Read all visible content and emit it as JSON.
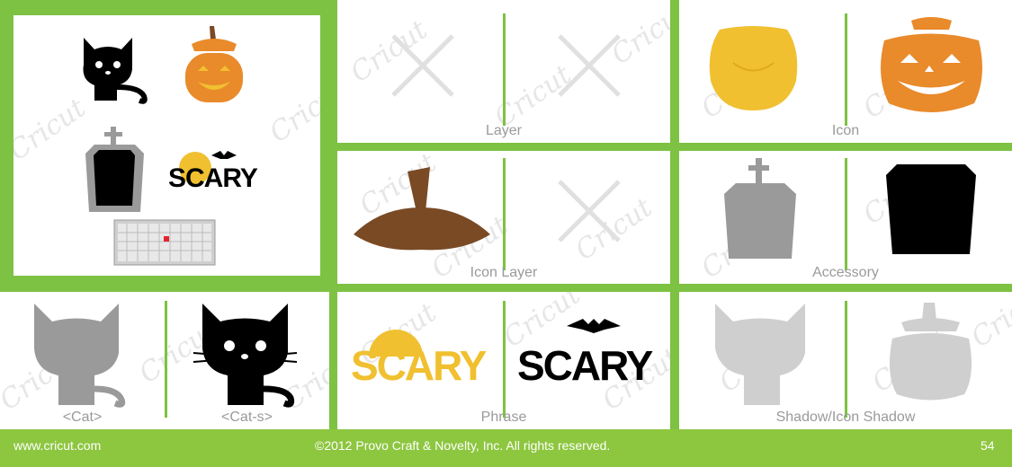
{
  "brand_watermark": "Cricut",
  "panels": {
    "layer": {
      "label": "Layer"
    },
    "icon": {
      "label": "Icon"
    },
    "icon_layer": {
      "label": "Icon Layer"
    },
    "accessory": {
      "label": "Accessory"
    },
    "cat": {
      "label_left": "<Cat>",
      "label_right": "<Cat-s>"
    },
    "phrase": {
      "label": "Phrase",
      "text_left": "SCARY",
      "text_right": "SCARY"
    },
    "shadow": {
      "label": "Shadow/Icon Shadow"
    },
    "overview": {
      "text": "SCARY"
    }
  },
  "footer": {
    "website": "www.cricut.com",
    "copyright": "©2012 Provo Craft & Novelty, Inc. All rights reserved.",
    "page_number": "54"
  },
  "colors": {
    "green": "#7dc242",
    "yellow": "#f0c030",
    "orange": "#e98a2b",
    "brown": "#7a4a25",
    "gray": "#9a9a9a",
    "black": "#000000"
  }
}
